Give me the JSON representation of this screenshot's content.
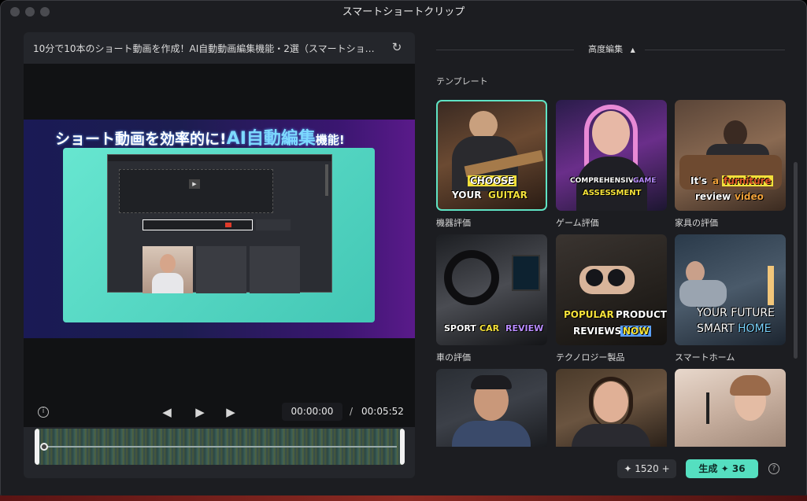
{
  "window": {
    "title": "スマートショートクリップ"
  },
  "preview": {
    "video_title": "10分で10本のショート動画を作成！AI自動動画編集機能・2選（スマートショート…",
    "thumb": {
      "banner_a": "ショート動画を効率的に!",
      "banner_b": "AI自動編集",
      "banner_c": "機能!"
    },
    "current_time": "00:00:00",
    "separator": "/",
    "total_time": "00:05:52"
  },
  "icons": {
    "refresh": "refresh-icon",
    "info": "info-icon",
    "prev": "skip-back-icon",
    "play": "play-icon",
    "next": "skip-forward-icon",
    "sparkle": "sparkle-icon",
    "plus": "plus-icon",
    "help": "help-icon"
  },
  "right": {
    "advanced_label": "高度編集",
    "section_label": "テンプレート",
    "templates": [
      {
        "label": "機器評価",
        "overlay_a": "CHOOSE",
        "overlay_b": "YOUR",
        "overlay_c": "GUITAR"
      },
      {
        "label": "ゲーム評価",
        "overlay_a": "COMPREHENSIVE",
        "overlay_b": "GAME",
        "overlay_c": "ASSESSMENT"
      },
      {
        "label": "家具の評価",
        "overlay_a": "It's",
        "overlay_b": "a",
        "overlay_c": "furniture",
        "overlay_d": "review",
        "overlay_e": "video"
      },
      {
        "label": "車の評価",
        "overlay_a": "SPORT",
        "overlay_b": "CAR",
        "overlay_c": "REVIEW"
      },
      {
        "label": "テクノロジー製品",
        "overlay_a": "POPULAR",
        "overlay_b": "PRODUCT",
        "overlay_c": "REVIEWS",
        "overlay_d": "NOW"
      },
      {
        "label": "スマートホーム",
        "overlay_a": "YOUR FUTURE",
        "overlay_b": "SMART",
        "overlay_c": "HOME"
      },
      {
        "label": ""
      },
      {
        "label": ""
      },
      {
        "label": ""
      }
    ]
  },
  "footer": {
    "credits": "1520",
    "generate_label": "生成",
    "generate_cost": "36",
    "help": "?"
  },
  "colors": {
    "accent": "#55dfc0",
    "bg": "#1c1d21",
    "panel": "#24262b"
  }
}
